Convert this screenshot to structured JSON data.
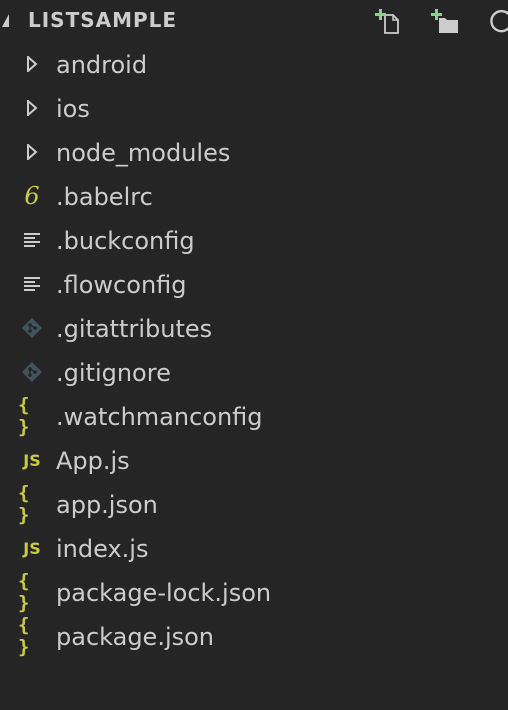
{
  "header": {
    "title": "LISTSAMPLE",
    "actions": [
      {
        "name": "new-file",
        "icon": "new-file-icon"
      },
      {
        "name": "new-folder",
        "icon": "new-folder-icon"
      },
      {
        "name": "refresh",
        "icon": "refresh-icon"
      }
    ]
  },
  "colors": {
    "background": "#252526",
    "text": "#cccccc",
    "accent_green": "#89d185",
    "json_yellow": "#cbcb41",
    "git_icon": "#41535b"
  },
  "tree": {
    "items": [
      {
        "label": "android",
        "type": "folder",
        "icon": "chevron-right-icon"
      },
      {
        "label": "ios",
        "type": "folder",
        "icon": "chevron-right-icon"
      },
      {
        "label": "node_modules",
        "type": "folder",
        "icon": "chevron-right-icon"
      },
      {
        "label": ".babelrc",
        "type": "file",
        "icon": "babel-icon",
        "glyph": "6"
      },
      {
        "label": ".buckconfig",
        "type": "file",
        "icon": "lines-icon"
      },
      {
        "label": ".flowconfig",
        "type": "file",
        "icon": "lines-icon"
      },
      {
        "label": ".gitattributes",
        "type": "file",
        "icon": "git-icon"
      },
      {
        "label": ".gitignore",
        "type": "file",
        "icon": "git-icon"
      },
      {
        "label": ".watchmanconfig",
        "type": "file",
        "icon": "json-icon",
        "glyph": "{ }"
      },
      {
        "label": "App.js",
        "type": "file",
        "icon": "js-icon",
        "glyph": "JS"
      },
      {
        "label": "app.json",
        "type": "file",
        "icon": "json-icon",
        "glyph": "{ }"
      },
      {
        "label": "index.js",
        "type": "file",
        "icon": "js-icon",
        "glyph": "JS"
      },
      {
        "label": "package-lock.json",
        "type": "file",
        "icon": "json-icon",
        "glyph": "{ }"
      },
      {
        "label": "package.json",
        "type": "file",
        "icon": "json-icon",
        "glyph": "{ }"
      }
    ]
  }
}
